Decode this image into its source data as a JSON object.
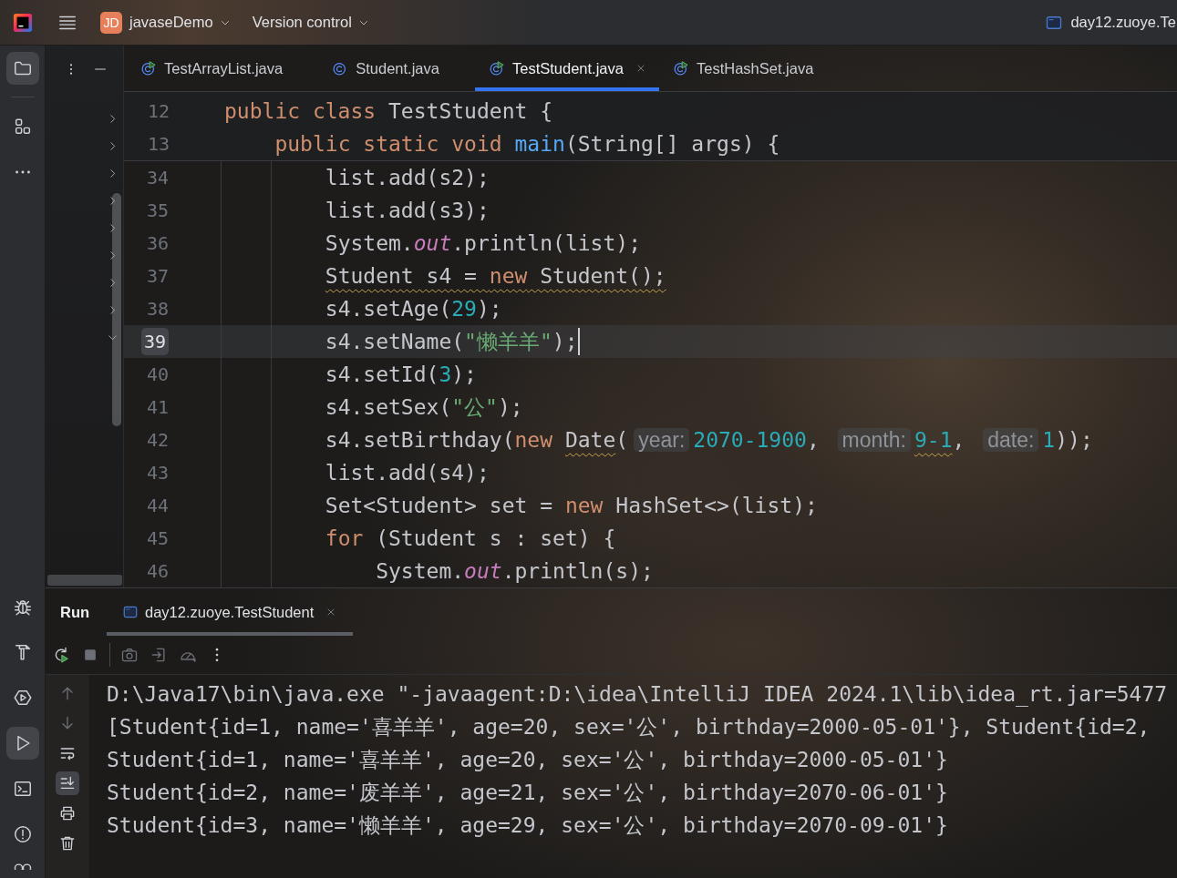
{
  "title_bar": {
    "project_badge": "JD",
    "project_name": "javaseDemo",
    "vcs_label": "Version control",
    "run_configuration": "day12.zuoye.Te"
  },
  "tool_strip": {
    "top": [
      {
        "kind": "project",
        "selected": true
      },
      {
        "kind": "structure",
        "selected": false
      },
      {
        "kind": "more",
        "selected": false
      }
    ],
    "bottom": [
      {
        "kind": "debug",
        "selected": false
      },
      {
        "kind": "build",
        "selected": false
      },
      {
        "kind": "services",
        "selected": false
      },
      {
        "kind": "run",
        "selected": true
      },
      {
        "kind": "terminal",
        "selected": false
      },
      {
        "kind": "problems",
        "selected": false
      },
      {
        "kind": "vcs",
        "selected": false
      }
    ]
  },
  "project_panel": {
    "nodes": [
      {
        "expanded": false
      },
      {
        "expanded": false
      },
      {
        "expanded": false
      },
      {
        "expanded": false
      },
      {
        "expanded": false
      },
      {
        "expanded": false
      },
      {
        "expanded": false
      },
      {
        "expanded": false
      },
      {
        "expanded": true
      }
    ]
  },
  "editor": {
    "tabs": [
      {
        "label": "TestArrayList.java",
        "kind": "runnable",
        "selected": false
      },
      {
        "label": "Student.java",
        "kind": "class",
        "selected": false
      },
      {
        "label": "TestStudent.java",
        "kind": "runnable",
        "selected": true
      },
      {
        "label": "TestHashSet.java",
        "kind": "runnable",
        "selected": false
      }
    ],
    "sticky_lines": [
      {
        "number": "12",
        "tokens": [
          {
            "text": "public class",
            "kind": "keyword"
          },
          {
            "text": " TestStudent {",
            "kind": "plain"
          }
        ]
      },
      {
        "number": "13",
        "tokens": [
          {
            "text": "    public static void ",
            "kind": "keyword"
          },
          {
            "text": "main",
            "kind": "method"
          },
          {
            "text": "(String[] args) {",
            "kind": "plain"
          }
        ]
      }
    ],
    "lines": [
      {
        "number": "34",
        "current": false,
        "tokens": [
          {
            "text": "        list.add(s2);",
            "kind": "plain",
            "warning": false
          }
        ]
      },
      {
        "number": "35",
        "current": false,
        "tokens": [
          {
            "text": "        list.add(s3);",
            "kind": "plain",
            "warning": false
          }
        ]
      },
      {
        "number": "36",
        "current": false,
        "tokens": [
          {
            "text": "        System.",
            "kind": "plain",
            "warning": false
          },
          {
            "text": "out",
            "kind": "field",
            "warning": false
          },
          {
            "text": ".println(list);",
            "kind": "plain",
            "warning": false
          }
        ]
      },
      {
        "number": "37",
        "current": false,
        "tokens": [
          {
            "text": "        Student s4 = ",
            "kind": "plain",
            "warning": true
          },
          {
            "text": "new",
            "kind": "keyword",
            "warning": true
          },
          {
            "text": " Student();",
            "kind": "plain",
            "warning": true
          }
        ]
      },
      {
        "number": "38",
        "current": false,
        "tokens": [
          {
            "text": "        s4.setAge(",
            "kind": "plain",
            "warning": false
          },
          {
            "text": "29",
            "kind": "number",
            "warning": false
          },
          {
            "text": ");",
            "kind": "plain",
            "warning": false
          }
        ]
      },
      {
        "number": "39",
        "current": true,
        "tokens": [
          {
            "text": "        s4.setName(",
            "kind": "plain",
            "warning": false
          },
          {
            "text": "\"懒羊羊\"",
            "kind": "string",
            "warning": false
          },
          {
            "text": ");",
            "kind": "plain",
            "warning": false
          }
        ]
      },
      {
        "number": "40",
        "current": false,
        "tokens": [
          {
            "text": "        s4.setId(",
            "kind": "plain",
            "warning": false
          },
          {
            "text": "3",
            "kind": "number",
            "warning": false
          },
          {
            "text": ");",
            "kind": "plain",
            "warning": false
          }
        ]
      },
      {
        "number": "41",
        "current": false,
        "tokens": [
          {
            "text": "        s4.setSex(",
            "kind": "plain",
            "warning": false
          },
          {
            "text": "\"公\"",
            "kind": "string",
            "warning": false
          },
          {
            "text": ");",
            "kind": "plain",
            "warning": false
          }
        ]
      },
      {
        "number": "42",
        "current": false,
        "tokens": [
          {
            "text": "        s4.setBirthday(",
            "kind": "plain",
            "warning": false
          },
          {
            "text": "new ",
            "kind": "keyword",
            "warning": false
          },
          {
            "text": "Date",
            "kind": "plain",
            "warning": true
          },
          {
            "text": "(",
            "kind": "plain",
            "warning": false
          },
          {
            "text": "year:",
            "kind": "hint",
            "warning": false
          },
          {
            "text": "2070-1900",
            "kind": "number",
            "warning": false
          },
          {
            "text": ", ",
            "kind": "plain",
            "warning": false
          },
          {
            "text": "month:",
            "kind": "hint",
            "warning": false
          },
          {
            "text": "9-1",
            "kind": "number",
            "warning": true
          },
          {
            "text": ", ",
            "kind": "plain",
            "warning": false
          },
          {
            "text": "date:",
            "kind": "hint",
            "warning": false
          },
          {
            "text": "1",
            "kind": "number",
            "warning": false
          },
          {
            "text": "));",
            "kind": "plain",
            "warning": false
          }
        ]
      },
      {
        "number": "43",
        "current": false,
        "tokens": [
          {
            "text": "        list.add(s4);",
            "kind": "plain",
            "warning": false
          }
        ]
      },
      {
        "number": "44",
        "current": false,
        "tokens": [
          {
            "text": "        Set<Student> set = ",
            "kind": "plain",
            "warning": false
          },
          {
            "text": "new",
            "kind": "keyword",
            "warning": false
          },
          {
            "text": " HashSet<>(list);",
            "kind": "plain",
            "warning": false
          }
        ]
      },
      {
        "number": "45",
        "current": false,
        "tokens": [
          {
            "text": "        for",
            "kind": "keyword",
            "warning": false
          },
          {
            "text": " (Student s : set) {",
            "kind": "plain",
            "warning": false
          }
        ]
      },
      {
        "number": "46",
        "current": false,
        "tokens": [
          {
            "text": "            System.",
            "kind": "plain",
            "warning": false
          },
          {
            "text": "out",
            "kind": "field",
            "warning": false
          },
          {
            "text": ".println(s);",
            "kind": "plain",
            "warning": false
          }
        ]
      }
    ]
  },
  "run_panel": {
    "title": "Run",
    "tab": {
      "label": "day12.zuoye.TestStudent",
      "selected": true
    },
    "toolbar": [
      {
        "kind": "rerun",
        "disabled": false
      },
      {
        "kind": "stop",
        "disabled": true
      },
      {
        "kind": "separator"
      },
      {
        "kind": "screenshot",
        "disabled": true
      },
      {
        "kind": "attach",
        "disabled": true
      },
      {
        "kind": "profiler",
        "disabled": true
      },
      {
        "kind": "more",
        "disabled": false
      }
    ],
    "side_toolbar": [
      {
        "kind": "up",
        "disabled": true,
        "on": false
      },
      {
        "kind": "down",
        "disabled": true,
        "on": false
      },
      {
        "kind": "soft_wrap",
        "disabled": false,
        "on": false
      },
      {
        "kind": "scroll_to_end",
        "disabled": false,
        "on": true
      },
      {
        "kind": "print",
        "disabled": false,
        "on": false
      },
      {
        "kind": "clear",
        "disabled": false,
        "on": false
      }
    ],
    "console": [
      "D:\\Java17\\bin\\java.exe \"-javaagent:D:\\idea\\IntelliJ IDEA 2024.1\\lib\\idea_rt.jar=5477",
      "[Student{id=1, name='喜羊羊', age=20, sex='公', birthday=2000-05-01'}, Student{id=2,",
      "Student{id=1, name='喜羊羊', age=20, sex='公', birthday=2000-05-01'}",
      "Student{id=2, name='废羊羊', age=21, sex='公', birthday=2070-06-01'}",
      "Student{id=3, name='懒羊羊', age=29, sex='公', birthday=2070-09-01'}"
    ]
  }
}
